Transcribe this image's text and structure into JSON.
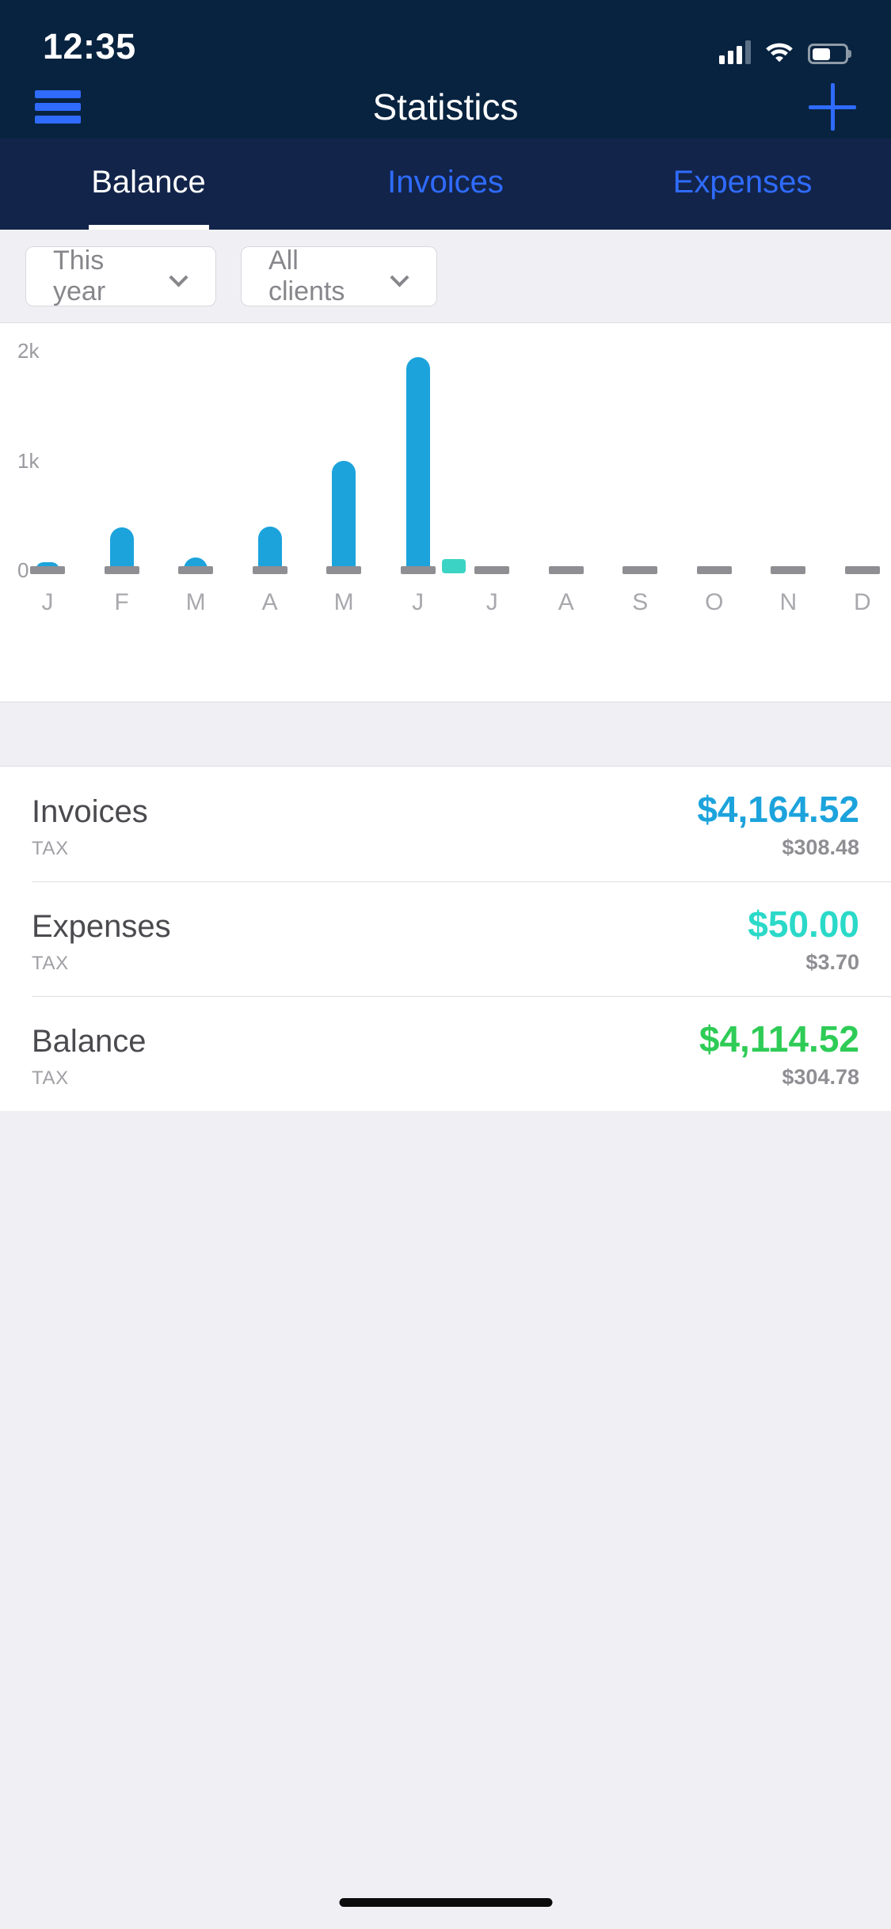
{
  "status_bar": {
    "time": "12:35",
    "icons": [
      "cellular-signal-icon",
      "wifi-icon",
      "battery-icon"
    ]
  },
  "header": {
    "title": "Statistics",
    "menu_icon": "hamburger-menu-icon",
    "add_icon": "plus-icon"
  },
  "tabs": [
    {
      "label": "Balance",
      "active": true
    },
    {
      "label": "Invoices",
      "active": false
    },
    {
      "label": "Expenses",
      "active": false
    }
  ],
  "filters": [
    {
      "label": "This year",
      "icon": "chevron-down-icon"
    },
    {
      "label": "All clients",
      "icon": "chevron-down-icon"
    }
  ],
  "chart_data": {
    "type": "bar",
    "title": "",
    "xlabel": "",
    "ylabel": "",
    "categories": [
      "J",
      "F",
      "M",
      "A",
      "M",
      "J",
      "J",
      "A",
      "S",
      "O",
      "N",
      "D"
    ],
    "month_names": [
      "January",
      "February",
      "March",
      "April",
      "May",
      "June",
      "July",
      "August",
      "September",
      "October",
      "November",
      "December"
    ],
    "series": [
      {
        "name": "Invoices",
        "color": "#1CA3DC",
        "values": [
          60,
          390,
          115,
          400,
          1000,
          1940,
          0,
          0,
          0,
          0,
          0,
          0
        ]
      },
      {
        "name": "Expenses",
        "color": "#3BD4C4",
        "values": [
          0,
          0,
          0,
          0,
          0,
          50,
          0,
          0,
          0,
          0,
          0,
          0
        ]
      }
    ],
    "ytick_labels": [
      "2k",
      "1k",
      "0"
    ],
    "ytick_values": [
      2000,
      1000,
      0
    ],
    "ylim": [
      0,
      2100
    ],
    "grid": false,
    "legend": "none",
    "baseline_dash_color": "#8E8E93"
  },
  "summary": {
    "tax_label": "TAX",
    "rows": [
      {
        "label": "Invoices",
        "amount": "$4,164.52",
        "amount_color": "#1CA3DC",
        "tax": "$308.48"
      },
      {
        "label": "Expenses",
        "amount": "$50.00",
        "amount_color": "#2BD9C8",
        "tax": "$3.70"
      },
      {
        "label": "Balance",
        "amount": "$4,114.52",
        "amount_color": "#2ECC56",
        "tax": "$304.78"
      }
    ]
  },
  "colors": {
    "navy": "#08233F",
    "tabbar_navy": "#12244A",
    "accent_blue": "#2F6BFF",
    "chart_blue": "#1CA3DC",
    "teal": "#2BD9C8",
    "green": "#2ECC56",
    "page_gray": "#F0F0F4"
  },
  "home_indicator": "home-indicator"
}
